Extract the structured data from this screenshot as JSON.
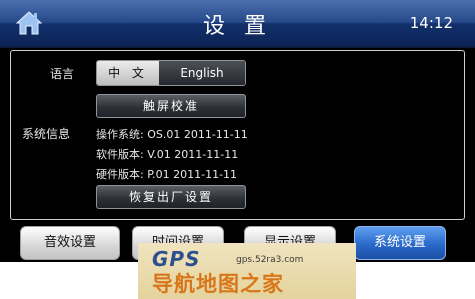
{
  "header": {
    "title": "设 置",
    "time": "14:12",
    "home_icon": "home-icon"
  },
  "language": {
    "label": "语言",
    "options": [
      "中 文",
      "English"
    ],
    "selected": "中 文"
  },
  "calibrate_button": "触屏校准",
  "system_info": {
    "label": "系统信息",
    "os": "操作系统: OS.01 2011-11-11",
    "software": "软件版本: V.01 2011-11-11",
    "hardware": "硬件版本: P.01 2011-11-11"
  },
  "reset_button": "恢复出厂设置",
  "tabs": [
    {
      "label": "音效设置",
      "active": false
    },
    {
      "label": "时间设置",
      "active": false
    },
    {
      "label": "显示设置",
      "active": false
    },
    {
      "label": "系统设置",
      "active": true
    }
  ],
  "watermark": {
    "brand": "GPS",
    "url": "gps.52ra3.com",
    "text": "导航地图之家"
  },
  "colors": {
    "titlebar": "#27498a",
    "active_tab": "#2a69c9",
    "background": "#000000"
  }
}
